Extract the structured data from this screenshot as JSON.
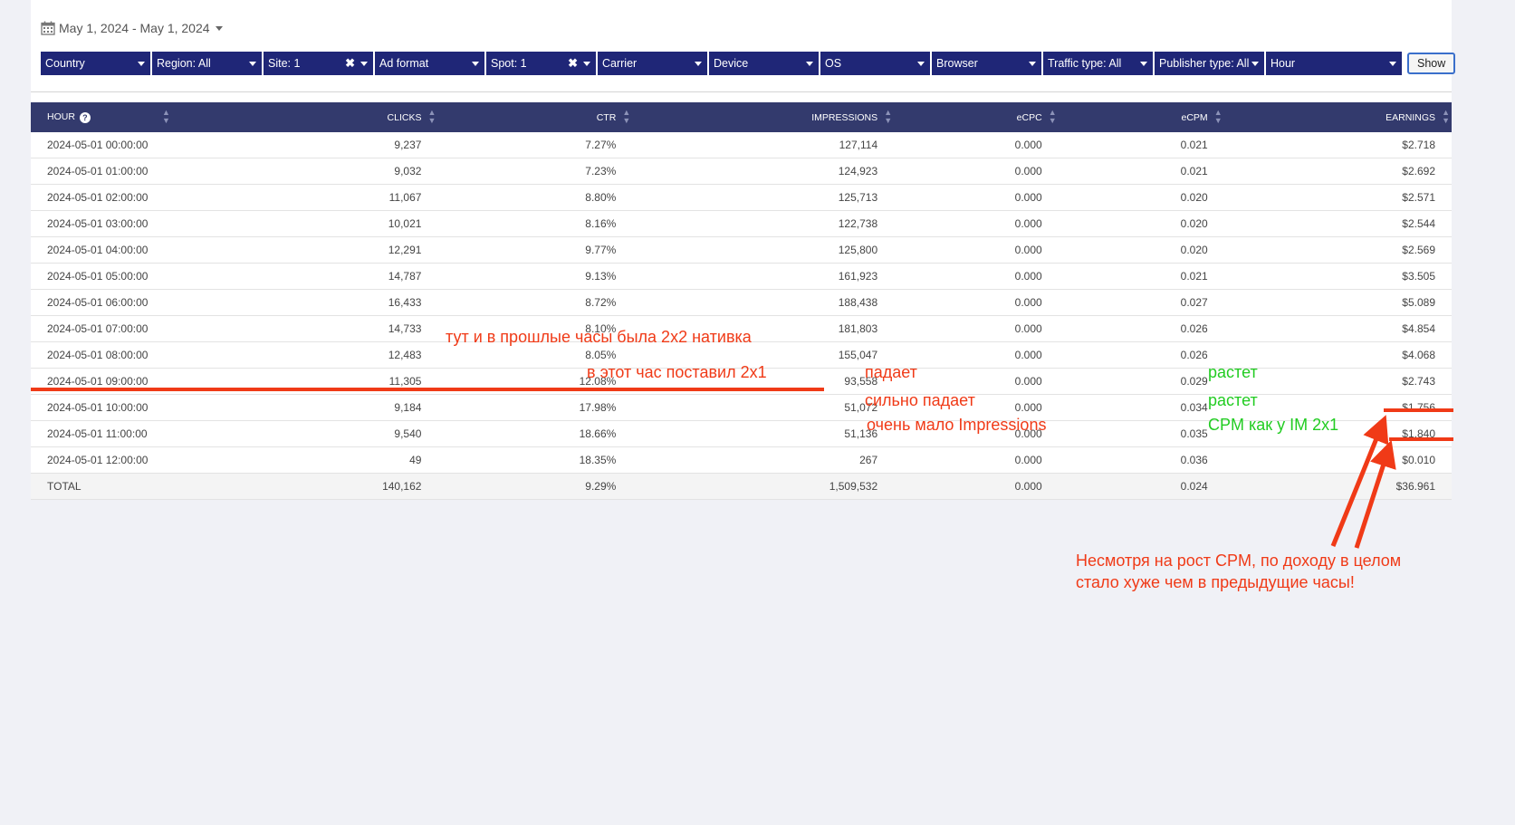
{
  "date_range": "May 1, 2024 - May 1, 2024",
  "filters": [
    {
      "label": "Country",
      "clearable": false
    },
    {
      "label": "Region: All",
      "clearable": false
    },
    {
      "label": "Site: 1",
      "clearable": true
    },
    {
      "label": "Ad format",
      "clearable": false
    },
    {
      "label": "Spot: 1",
      "clearable": true
    },
    {
      "label": "Carrier",
      "clearable": false
    },
    {
      "label": "Device",
      "clearable": false
    },
    {
      "label": "OS",
      "clearable": false
    },
    {
      "label": "Browser",
      "clearable": false
    },
    {
      "label": "Traffic type: All",
      "clearable": false
    },
    {
      "label": "Publisher type: All",
      "clearable": false
    },
    {
      "label": "Hour",
      "clearable": false
    }
  ],
  "clear_glyph": "✖",
  "show_label": "Show",
  "help_glyph": "?",
  "table": {
    "columns": [
      "HOUR",
      "CLICKS",
      "CTR",
      "IMPRESSIONS",
      "eCPC",
      "eCPM",
      "EARNINGS"
    ],
    "rows": [
      [
        "2024-05-01 00:00:00",
        "9,237",
        "7.27%",
        "127,114",
        "0.000",
        "0.021",
        "$2.718"
      ],
      [
        "2024-05-01 01:00:00",
        "9,032",
        "7.23%",
        "124,923",
        "0.000",
        "0.021",
        "$2.692"
      ],
      [
        "2024-05-01 02:00:00",
        "11,067",
        "8.80%",
        "125,713",
        "0.000",
        "0.020",
        "$2.571"
      ],
      [
        "2024-05-01 03:00:00",
        "10,021",
        "8.16%",
        "122,738",
        "0.000",
        "0.020",
        "$2.544"
      ],
      [
        "2024-05-01 04:00:00",
        "12,291",
        "9.77%",
        "125,800",
        "0.000",
        "0.020",
        "$2.569"
      ],
      [
        "2024-05-01 05:00:00",
        "14,787",
        "9.13%",
        "161,923",
        "0.000",
        "0.021",
        "$3.505"
      ],
      [
        "2024-05-01 06:00:00",
        "16,433",
        "8.72%",
        "188,438",
        "0.000",
        "0.027",
        "$5.089"
      ],
      [
        "2024-05-01 07:00:00",
        "14,733",
        "8.10%",
        "181,803",
        "0.000",
        "0.026",
        "$4.854"
      ],
      [
        "2024-05-01 08:00:00",
        "12,483",
        "8.05%",
        "155,047",
        "0.000",
        "0.026",
        "$4.068"
      ],
      [
        "2024-05-01 09:00:00",
        "11,305",
        "12.08%",
        "93,558",
        "0.000",
        "0.029",
        "$2.743"
      ],
      [
        "2024-05-01 10:00:00",
        "9,184",
        "17.98%",
        "51,072",
        "0.000",
        "0.034",
        "$1.756"
      ],
      [
        "2024-05-01 11:00:00",
        "9,540",
        "18.66%",
        "51,136",
        "0.000",
        "0.035",
        "$1.840"
      ],
      [
        "2024-05-01 12:00:00",
        "49",
        "18.35%",
        "267",
        "0.000",
        "0.036",
        "$0.010"
      ]
    ],
    "total": [
      "TOTAL",
      "140,162",
      "9.29%",
      "1,509,532",
      "0.000",
      "0.024",
      "$36.961"
    ]
  },
  "annotations": {
    "native_2x2": "тут и в прошлые часы была 2х2 нативка",
    "set_2x1": "в этот час поставил 2х1",
    "falling": "падает",
    "strongly_falling": "сильно падает",
    "few_impressions": "очень мало Impressions",
    "growing_1": "растет",
    "growing_2": "растет",
    "cpm_like_im": "CPM как у IM 2х1",
    "conclusion_line1": "Несмотря на рост CPM, по доходу в целом",
    "conclusion_line2": "стало хуже чем в предыдущие часы!"
  },
  "colors": {
    "filter_bg": "#1f2677",
    "header_bg": "#333a6d",
    "annotation_red": "#f03a17",
    "annotation_green": "#22cc22"
  }
}
